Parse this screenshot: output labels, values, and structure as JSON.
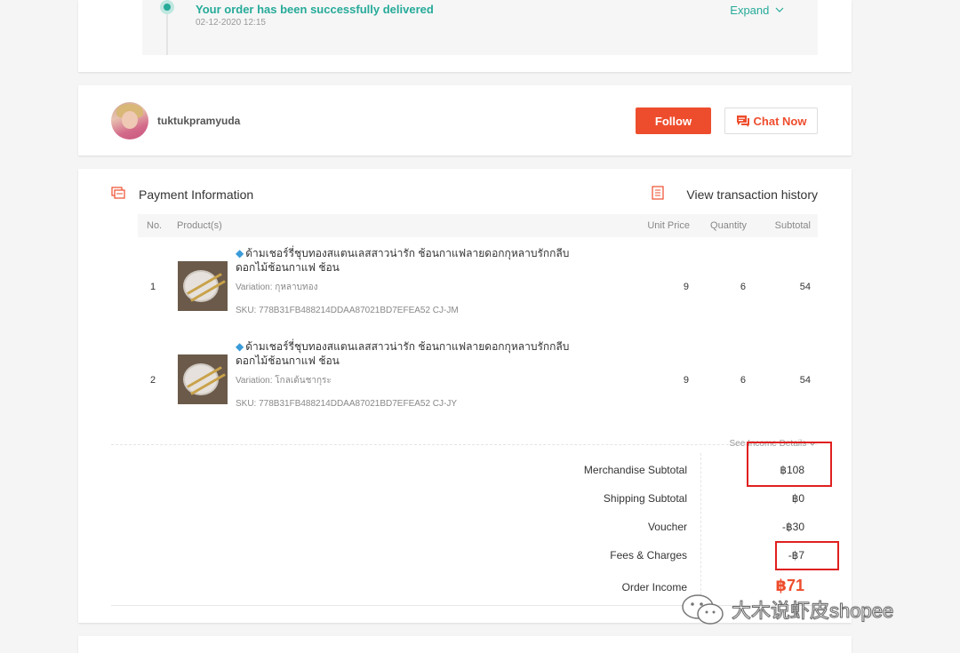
{
  "status": {
    "message": "Your order has been successfully delivered",
    "time": "02-12-2020 12:15",
    "expand_label": "Expand"
  },
  "seller": {
    "username": "tuktukpramyuda",
    "follow_label": "Follow",
    "chat_label": "Chat Now"
  },
  "payment": {
    "title": "Payment Information",
    "history_label": "View transaction history",
    "columns": {
      "no": "No.",
      "product": "Product(s)",
      "unit_price": "Unit Price",
      "quantity": "Quantity",
      "subtotal": "Subtotal"
    },
    "items": [
      {
        "no": "1",
        "name": "ด้ามเชอร์รี่ชุบทองสแตนเลสสาวน่ารัก ช้อนกาแฟลายดอกกุหลาบรักกลีบดอกไม้ช้อนกาแฟ ช้อน",
        "variation": "Variation: กุหลาบทอง",
        "sku": "SKU: 778B31FB488214DDAA87021BD7EFEA52 CJ-JM",
        "unit_price": "9",
        "quantity": "6",
        "subtotal": "54"
      },
      {
        "no": "2",
        "name": "ด้ามเชอร์รี่ชุบทองสแตนเลสสาวน่ารัก ช้อนกาแฟลายดอกกุหลาบรักกลีบดอกไม้ช้อนกาแฟ ช้อน",
        "variation": "Variation: โกลเด้นชากุระ",
        "sku": "SKU: 778B31FB488214DDAA87021BD7EFEA52 CJ-JY",
        "unit_price": "9",
        "quantity": "6",
        "subtotal": "54"
      }
    ],
    "see_income_label": "See Income Details",
    "summary": {
      "merchandise_label": "Merchandise Subtotal",
      "merchandise_value": "฿108",
      "shipping_label": "Shipping Subtotal",
      "shipping_value": "฿0",
      "voucher_label": "Voucher",
      "voucher_value": "-฿30",
      "fees_label": "Fees & Charges",
      "fees_value": "-฿7",
      "income_label": "Order Income",
      "income_value": "฿71"
    }
  },
  "watermark": "大木说虾皮shopee",
  "colors": {
    "brand": "#ee4d2d",
    "success": "#26aa99",
    "highlight": "#e02020"
  }
}
